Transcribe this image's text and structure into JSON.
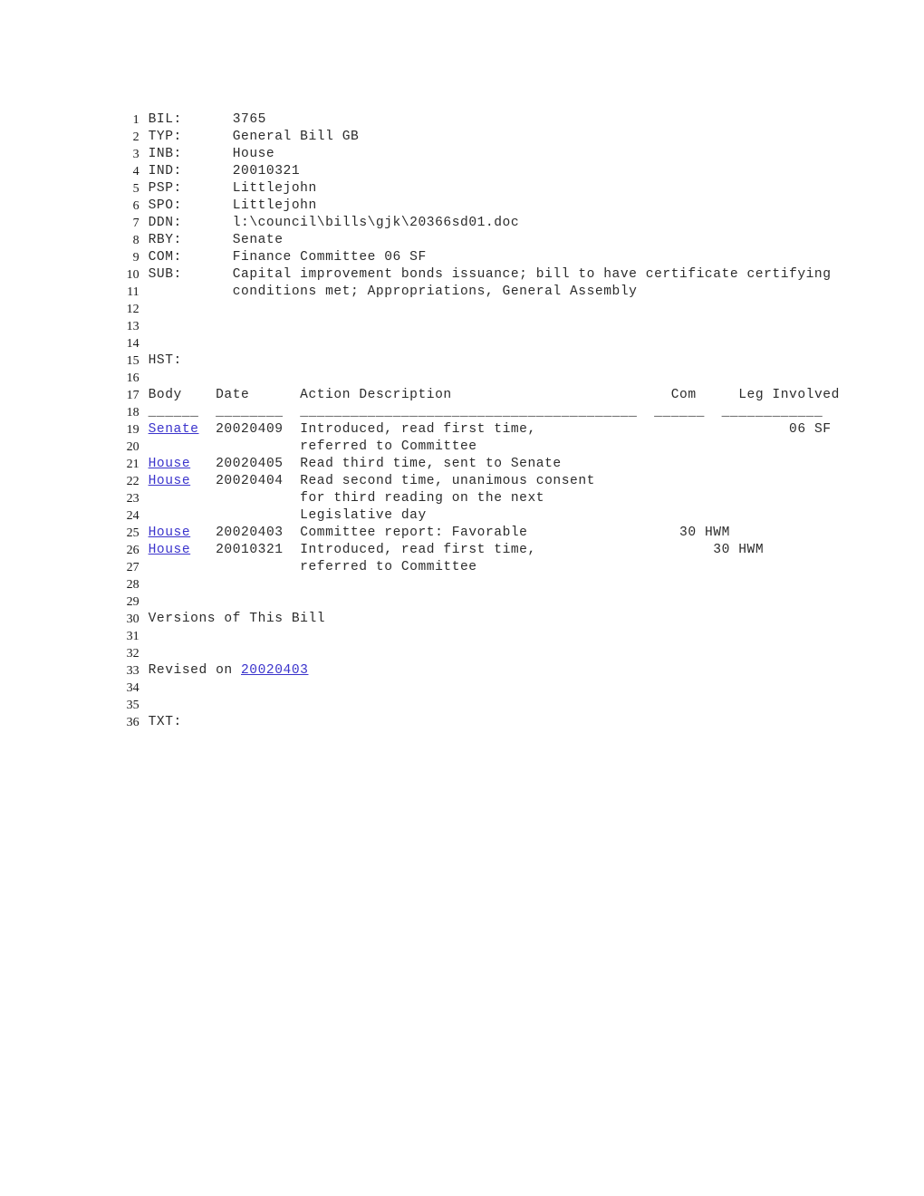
{
  "document": {
    "kind": "legislative-bill-record",
    "background_color": "#ffffff",
    "text_color": "#2b2b2b",
    "link_color": "#3b34cc",
    "line_number_color": "#1a1a1a",
    "first_line_number": 1,
    "last_line_number": 36
  },
  "fields": {
    "bill_label": "BIL:",
    "bill_value": "3765",
    "type_label": "TYP:",
    "type_value": "General Bill GB",
    "introduced_body_label": "INB:",
    "introduced_body_value": "House",
    "introduced_date_label": "IND:",
    "introduced_date_value": "20010321",
    "primary_sponsor_label": "PSP:",
    "primary_sponsor_value": "Littlejohn",
    "sponsor_label": "SPO:",
    "sponsor_value": "Littlejohn",
    "document_name_label": "DDN:",
    "document_name_value": "l:\\council\\bills\\gjk\\20366sd01.doc",
    "received_by_label": "RBY:",
    "received_by_value": "Senate",
    "committee_label": "COM:",
    "committee_value": "Finance Committee 06 SF",
    "subject_label": "SUB:",
    "subject_line1": "Capital improvement bonds issuance; bill to have certificate certifying",
    "subject_line2": "conditions met; Appropriations, General Assembly"
  },
  "history": {
    "section_label": "HST:",
    "columns": {
      "body": "Body",
      "date": "Date",
      "action": "Action Description",
      "com": "Com",
      "leg_involved": "Leg Involved"
    },
    "separators": {
      "body": "______",
      "date": "________",
      "action": "________________________________________",
      "com": "______",
      "leg_involved": "____________"
    },
    "rows": [
      {
        "body": "Senate",
        "body_is_link": true,
        "date": "20020409",
        "action": "Introduced, read first time,",
        "action_cont": "referred to Committee",
        "com": "06 SF",
        "leg_involved": ""
      },
      {
        "body": "House",
        "body_is_link": true,
        "date": "20020405",
        "action": "Read third time, sent to Senate",
        "action_cont": "",
        "com": "",
        "leg_involved": ""
      },
      {
        "body": "House",
        "body_is_link": true,
        "date": "20020404",
        "action": "Read second time, unanimous consent",
        "action_cont": "for third reading on the next",
        "action_cont2": "Legislative day",
        "com": "",
        "leg_involved": ""
      },
      {
        "body": "House",
        "body_is_link": true,
        "date": "20020403",
        "action": "Committee report: Favorable",
        "action_cont": "",
        "com": "30 HWM",
        "leg_involved": ""
      },
      {
        "body": "House",
        "body_is_link": true,
        "date": "20010321",
        "action": "Introduced, read first time,",
        "action_cont": "referred to Committee",
        "com": "30 HWM",
        "leg_involved": ""
      }
    ]
  },
  "versions": {
    "heading": "Versions of This Bill",
    "revised_prefix": "Revised on ",
    "revised_date": "20020403"
  },
  "text_section": {
    "label": "TXT:"
  },
  "lines": [
    {
      "n": "1",
      "type": "field"
    },
    {
      "n": "2",
      "type": "field"
    },
    {
      "n": "3",
      "type": "field"
    },
    {
      "n": "4",
      "type": "field"
    },
    {
      "n": "5",
      "type": "field"
    },
    {
      "n": "6",
      "type": "field"
    },
    {
      "n": "7",
      "type": "field"
    },
    {
      "n": "8",
      "type": "field"
    },
    {
      "n": "9",
      "type": "field"
    },
    {
      "n": "10",
      "type": "field"
    },
    {
      "n": "11",
      "type": "field-cont"
    },
    {
      "n": "12",
      "type": "blank"
    },
    {
      "n": "13",
      "type": "blank"
    },
    {
      "n": "14",
      "type": "blank"
    },
    {
      "n": "15",
      "type": "section"
    },
    {
      "n": "16",
      "type": "blank"
    },
    {
      "n": "17",
      "type": "header"
    },
    {
      "n": "18",
      "type": "separator"
    },
    {
      "n": "19",
      "type": "row"
    },
    {
      "n": "20",
      "type": "row-cont"
    },
    {
      "n": "21",
      "type": "row"
    },
    {
      "n": "22",
      "type": "row"
    },
    {
      "n": "23",
      "type": "row-cont"
    },
    {
      "n": "24",
      "type": "row-cont"
    },
    {
      "n": "25",
      "type": "row"
    },
    {
      "n": "26",
      "type": "row"
    },
    {
      "n": "27",
      "type": "row-cont"
    },
    {
      "n": "28",
      "type": "blank"
    },
    {
      "n": "29",
      "type": "blank"
    },
    {
      "n": "30",
      "type": "heading"
    },
    {
      "n": "31",
      "type": "blank"
    },
    {
      "n": "32",
      "type": "blank"
    },
    {
      "n": "33",
      "type": "revised"
    },
    {
      "n": "34",
      "type": "blank"
    },
    {
      "n": "35",
      "type": "blank"
    },
    {
      "n": "36",
      "type": "section"
    }
  ]
}
